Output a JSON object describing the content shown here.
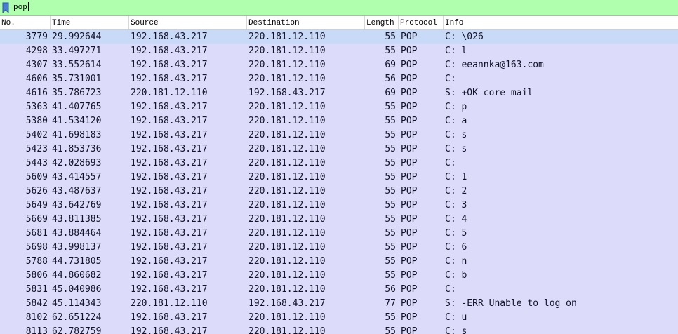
{
  "filter": {
    "value": "pop",
    "bar_color": "#afffaf"
  },
  "columns": [
    "No.",
    "Time",
    "Source",
    "Destination",
    "Length",
    "Protocol",
    "Info"
  ],
  "row_color": "#dcdcfa",
  "selected_row_color": "#c9daf8",
  "packets": [
    {
      "no": "3779",
      "time": "29.992644",
      "src": "192.168.43.217",
      "dst": "220.181.12.110",
      "len": "55",
      "proto": "POP",
      "info": "C: \\026",
      "selected": true
    },
    {
      "no": "4298",
      "time": "33.497271",
      "src": "192.168.43.217",
      "dst": "220.181.12.110",
      "len": "55",
      "proto": "POP",
      "info": "C: l"
    },
    {
      "no": "4307",
      "time": "33.552614",
      "src": "192.168.43.217",
      "dst": "220.181.12.110",
      "len": "69",
      "proto": "POP",
      "info": "C: eeannka@163.com"
    },
    {
      "no": "4606",
      "time": "35.731001",
      "src": "192.168.43.217",
      "dst": "220.181.12.110",
      "len": "56",
      "proto": "POP",
      "info": "C:"
    },
    {
      "no": "4616",
      "time": "35.786723",
      "src": "220.181.12.110",
      "dst": "192.168.43.217",
      "len": "69",
      "proto": "POP",
      "info": "S: +OK core mail"
    },
    {
      "no": "5363",
      "time": "41.407765",
      "src": "192.168.43.217",
      "dst": "220.181.12.110",
      "len": "55",
      "proto": "POP",
      "info": "C: p"
    },
    {
      "no": "5380",
      "time": "41.534120",
      "src": "192.168.43.217",
      "dst": "220.181.12.110",
      "len": "55",
      "proto": "POP",
      "info": "C: a"
    },
    {
      "no": "5402",
      "time": "41.698183",
      "src": "192.168.43.217",
      "dst": "220.181.12.110",
      "len": "55",
      "proto": "POP",
      "info": "C: s"
    },
    {
      "no": "5423",
      "time": "41.853736",
      "src": "192.168.43.217",
      "dst": "220.181.12.110",
      "len": "55",
      "proto": "POP",
      "info": "C: s"
    },
    {
      "no": "5443",
      "time": "42.028693",
      "src": "192.168.43.217",
      "dst": "220.181.12.110",
      "len": "55",
      "proto": "POP",
      "info": "C:"
    },
    {
      "no": "5609",
      "time": "43.414557",
      "src": "192.168.43.217",
      "dst": "220.181.12.110",
      "len": "55",
      "proto": "POP",
      "info": "C: 1"
    },
    {
      "no": "5626",
      "time": "43.487637",
      "src": "192.168.43.217",
      "dst": "220.181.12.110",
      "len": "55",
      "proto": "POP",
      "info": "C: 2"
    },
    {
      "no": "5649",
      "time": "43.642769",
      "src": "192.168.43.217",
      "dst": "220.181.12.110",
      "len": "55",
      "proto": "POP",
      "info": "C: 3"
    },
    {
      "no": "5669",
      "time": "43.811385",
      "src": "192.168.43.217",
      "dst": "220.181.12.110",
      "len": "55",
      "proto": "POP",
      "info": "C: 4"
    },
    {
      "no": "5681",
      "time": "43.884464",
      "src": "192.168.43.217",
      "dst": "220.181.12.110",
      "len": "55",
      "proto": "POP",
      "info": "C: 5"
    },
    {
      "no": "5698",
      "time": "43.998137",
      "src": "192.168.43.217",
      "dst": "220.181.12.110",
      "len": "55",
      "proto": "POP",
      "info": "C: 6"
    },
    {
      "no": "5788",
      "time": "44.731805",
      "src": "192.168.43.217",
      "dst": "220.181.12.110",
      "len": "55",
      "proto": "POP",
      "info": "C: n"
    },
    {
      "no": "5806",
      "time": "44.860682",
      "src": "192.168.43.217",
      "dst": "220.181.12.110",
      "len": "55",
      "proto": "POP",
      "info": "C: b"
    },
    {
      "no": "5831",
      "time": "45.040986",
      "src": "192.168.43.217",
      "dst": "220.181.12.110",
      "len": "56",
      "proto": "POP",
      "info": "C:"
    },
    {
      "no": "5842",
      "time": "45.114343",
      "src": "220.181.12.110",
      "dst": "192.168.43.217",
      "len": "77",
      "proto": "POP",
      "info": "S: -ERR Unable to log on"
    },
    {
      "no": "8102",
      "time": "62.651224",
      "src": "192.168.43.217",
      "dst": "220.181.12.110",
      "len": "55",
      "proto": "POP",
      "info": "C: u"
    },
    {
      "no": "8113",
      "time": "62.782759",
      "src": "192.168.43.217",
      "dst": "220.181.12.110",
      "len": "55",
      "proto": "POP",
      "info": "C: s"
    }
  ]
}
